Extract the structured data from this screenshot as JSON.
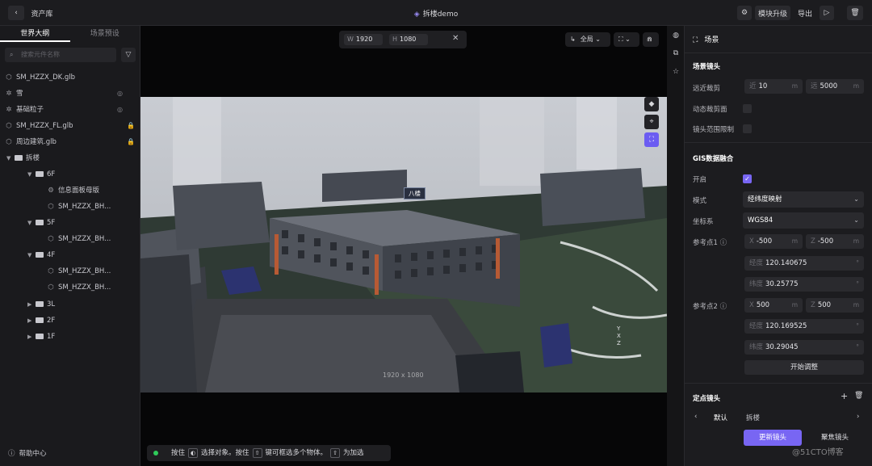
{
  "topbar": {
    "back": "‹",
    "asset_lib": "资产库",
    "title": "拆楼demo",
    "upgrade": "模块升级",
    "export": "导出"
  },
  "left": {
    "tabs": [
      "世界大纲",
      "场景预设"
    ],
    "search_placeholder": "搜索元件名称",
    "items": [
      {
        "label": "SM_HZZX_DK.glb"
      },
      {
        "label": "雪"
      },
      {
        "label": "基础粒子"
      },
      {
        "label": "SM_HZZX_FL.glb"
      },
      {
        "label": "周边建筑.glb"
      },
      {
        "label": "拆楼"
      },
      {
        "label": "6F"
      },
      {
        "label": "信息面板母版"
      },
      {
        "label": "SM_HZZX_BH..."
      },
      {
        "label": "5F"
      },
      {
        "label": "SM_HZZX_BH..."
      },
      {
        "label": "4F"
      },
      {
        "label": "SM_HZZX_BH..."
      },
      {
        "label": "SM_HZZX_BH..."
      },
      {
        "label": "3L"
      },
      {
        "label": "2F"
      },
      {
        "label": "1F"
      }
    ],
    "help": "帮助中心"
  },
  "viewport": {
    "w_label": "W",
    "w_value": "1920",
    "h_label": "H",
    "h_value": "1080",
    "view_mode": "全局",
    "scene_size": "1920 x 1080",
    "tag_label": "八楼",
    "axis_x": "X",
    "axis_y": "Y",
    "axis_z": "Z",
    "hint": {
      "press": "按住",
      "select": "选择对象。按住",
      "multi": "键可框选多个物体。",
      "add": "为加选"
    }
  },
  "panel": {
    "header": "场景",
    "camera_section": "场景镜头",
    "near_far_label": "远近裁剪",
    "near_prefix": "近",
    "near_value": "10",
    "far_prefix": "远",
    "far_value": "5000",
    "unit_m": "m",
    "dynamic_clip_label": "动态裁剪面",
    "range_limit_label": "镜头范围限制",
    "gis_section": "GIS数据融合",
    "enable_label": "开启",
    "mode_label": "模式",
    "mode_value": "经纬度映射",
    "coord_label": "坐标系",
    "coord_value": "WGS84",
    "ref1_label": "参考点1",
    "ref1_x": "-500",
    "ref1_z": "-500",
    "ref1_lon": "120.140675",
    "ref1_lat": "30.25775",
    "ref2_label": "参考点2",
    "ref2_x": "500",
    "ref2_z": "500",
    "ref2_lon": "120.169525",
    "ref2_lat": "30.29045",
    "lon_prefix": "经度",
    "lat_prefix": "纬度",
    "deg": "°",
    "start_adjust": "开始调整",
    "fixed_camera_section": "定点镜头",
    "default_label": "默认",
    "default_value": "拆楼",
    "update_camera": "更新镜头",
    "focus_camera": "聚焦镜头"
  },
  "watermark": "@51CTO博客"
}
